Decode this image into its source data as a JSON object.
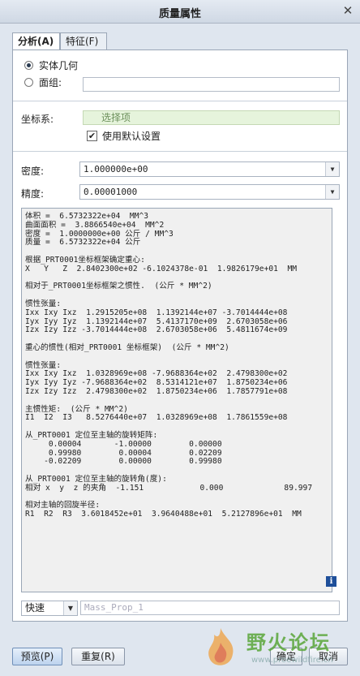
{
  "window": {
    "title": "质量属性",
    "close_glyph": "✕"
  },
  "tabs": [
    {
      "label": "分析(A)"
    },
    {
      "label": "特征(F)"
    }
  ],
  "geometry": {
    "solid_label": "实体几何",
    "quilt_label": "面组:"
  },
  "coordinate": {
    "label": "坐标系:",
    "placeholder": "选择项",
    "use_default_label": "使用默认设置",
    "use_default_checked": true
  },
  "density": {
    "label": "密度:",
    "value": "1.000000e+00"
  },
  "accuracy": {
    "label": "精度:",
    "value": "0.00001000"
  },
  "results_text": "体积 =  6.5732322e+04  MM^3\n曲面面积 =  3.8866540e+04  MM^2\n密度 =  1.0000000e+00 公斤 / MM^3\n质量 =  6.5732322e+04 公斤\n\n根据_PRT0001坐标框架确定重心:\nX   Y   Z  2.8402300e+02 -6.1024378e-01  1.9826179e+01  MM\n\n相对于_PRT0001坐标框架之惯性.  (公斤 * MM^2)\n\n惯性张量:\nIxx Ixy Ixz  1.2915205e+08  1.1392144e+07 -3.7014444e+08\nIyx Iyy Iyz  1.1392144e+07  5.4137170e+09  2.6703058e+06\nIzx Izy Izz -3.7014444e+08  2.6703058e+06  5.4811674e+09\n\n重心的惯性(相对_PRT0001 坐标框架)  (公斤 * MM^2)\n\n惯性张量:\nIxx Ixy Ixz  1.0328969e+08 -7.9688364e+02  2.4798300e+02\nIyx Iyy Iyz -7.9688364e+02  8.5314121e+07  1.8750234e+06\nIzx Izy Izz  2.4798300e+02  1.8750234e+06  1.7857791e+08\n\n主惯性矩:  (公斤 * MM^2)\nI1  I2  I3   8.5276440e+07  1.0328969e+08  1.7861559e+08\n\n从_PRT0001 定位至主轴的旋转矩阵:\n     0.00004       -1.00000        0.00000\n     0.99980        0.00004        0.02209\n    -0.02209        0.00000        0.99980\n\n从_PRT0001 定位至主轴的旋转角(度):\n相对 x  y  z 的夹角  -1.151            0.000             89.997\n\n相对主轴的回旋半径:\nR1  R2  R3  3.6018452e+01  3.9640488e+01  5.2127896e+01  MM",
  "mode": {
    "value": "快速",
    "name_placeholder": "Mass_Prop_1"
  },
  "buttons": {
    "preview": "预览(P)",
    "repeat": "重复(R)",
    "ok": "确定",
    "cancel": "取消"
  },
  "watermark": {
    "text": "野火论坛",
    "sub": "www.proewildfire.cn"
  }
}
